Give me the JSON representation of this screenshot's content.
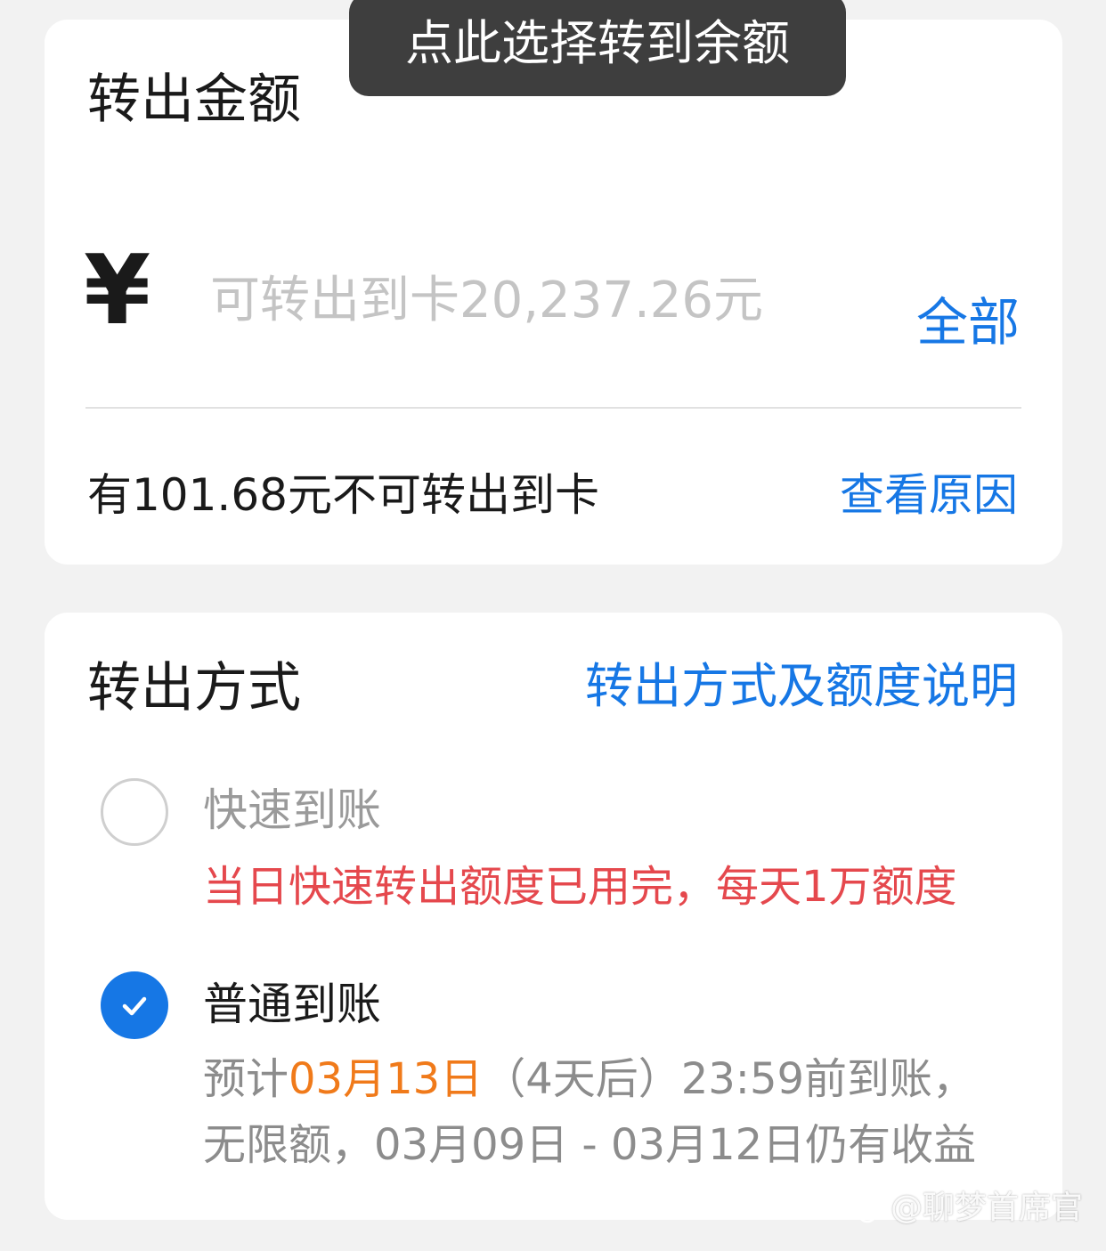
{
  "tooltip": {
    "text": "点此选择转到余额"
  },
  "amount_card": {
    "title": "转出金额",
    "currency_symbol": "¥",
    "input_value": "",
    "input_placeholder": "可转出到卡20,237.26元",
    "all_label": "全部",
    "note": "有101.68元不可转出到卡",
    "reason_link": "查看原因"
  },
  "method_card": {
    "title": "转出方式",
    "limit_link": "转出方式及额度说明",
    "options": [
      {
        "label": "快速到账",
        "selected": false,
        "message": "当日快速转出额度已用完，每天1万额度"
      },
      {
        "label": "普通到账",
        "selected": true,
        "detail_line1_prefix": "预计",
        "detail_line1_date": "03月13日",
        "detail_line1_suffix": "（4天后）23:59前到账，",
        "detail_line2": "无限额，03月09日 - 03月12日仍有收益"
      }
    ]
  },
  "colors": {
    "accent": "#1677e5",
    "warning": "#e5484d",
    "highlight": "#f07a1a",
    "muted": "#8c8c8c"
  },
  "icons": {
    "unselected_radio": "radio-unchecked-icon",
    "selected_radio": "checkmark-icon",
    "watermark": "paw-icon"
  },
  "watermark": {
    "text": "@聊梦首席官"
  }
}
